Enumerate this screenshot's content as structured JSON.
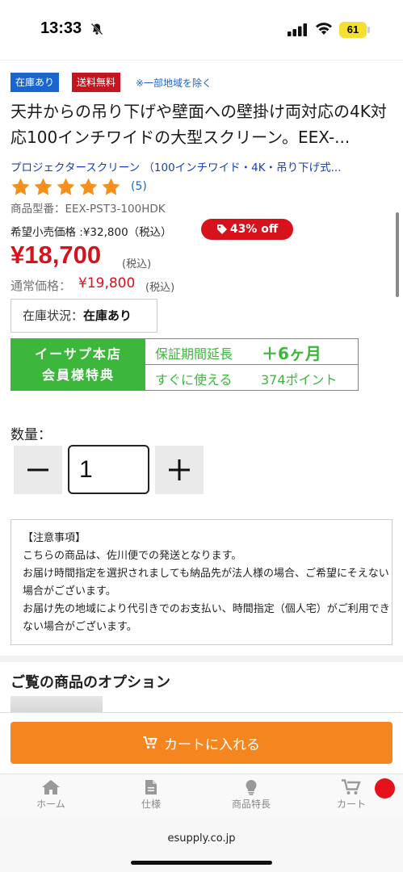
{
  "status_bar": {
    "time": "13:33",
    "battery": "61",
    "icons": [
      "bell-slash-icon",
      "signal-icon",
      "wifi-icon",
      "battery-icon"
    ]
  },
  "badges": {
    "stock": "在庫あり",
    "shipping": "送料無料",
    "note": "※一部地域を除く"
  },
  "product": {
    "title": "天井からの吊り下げや壁面への壁掛け両対応の4K対応100インチワイドの大型スクリーン。EEX-...",
    "category": "プロジェクタースクリーン （100インチワイド・4K・吊り下げ式...",
    "rating": 5,
    "review_count": "(5)",
    "model": "商品型番：EEX-PST3-100HDK",
    "msrp": "希望小売価格 :¥32,800（税込）",
    "discount": "43% off",
    "price": "¥18,700",
    "price_tax": "(税込)",
    "regular_label": "通常価格：",
    "regular_price": "¥19,800",
    "regular_tax": "(税込)",
    "stock_label": "在庫状況：",
    "stock_value": "在庫あり"
  },
  "member": {
    "line1": "イーサプ本店",
    "line2": "会員様特典",
    "row1_label": "保証期間延長",
    "row1_value": "＋6ヶ月",
    "row2_label": "すぐに使える",
    "row2_value": "374ポイント"
  },
  "quantity": {
    "label": "数量：",
    "value": "1"
  },
  "notice": {
    "heading": "【注意事項】",
    "lines": [
      "こちらの商品は、佐川便での発送となります。",
      "お届け時間指定を選択されましても納品先が法人様の場合、ご希望にそえない場合がございます。",
      "お届け先の地域により代引きでのお支払い、時間指定（個人宅）がご利用できない場合がございます。"
    ]
  },
  "options": {
    "heading": "ご覧の商品のオプション"
  },
  "cart_button": {
    "label": "カートに入れる"
  },
  "bottom_nav": {
    "items": [
      {
        "label": "ホーム",
        "icon": "home-icon"
      },
      {
        "label": "仕様",
        "icon": "document-icon"
      },
      {
        "label": "商品特長",
        "icon": "lightbulb-icon"
      },
      {
        "label": "カート",
        "icon": "cart-icon"
      }
    ]
  },
  "browser": {
    "url": "esupply.co.jp"
  },
  "colors": {
    "accent_red": "#d6121c",
    "accent_blue": "#1a66d0",
    "member_green": "#3cb73c",
    "cart_orange": "#f5861f",
    "star_orange": "#f5901e"
  }
}
